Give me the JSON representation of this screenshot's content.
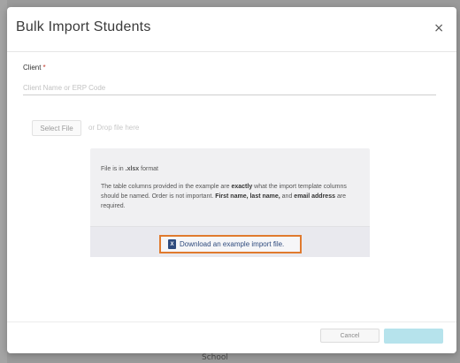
{
  "modal": {
    "title": "Bulk Import Students",
    "close_symbol": "×"
  },
  "client_field": {
    "label": "Client",
    "required_mark": "*",
    "placeholder": "Client Name or ERP Code",
    "value": ""
  },
  "file_select": {
    "button_label": "Select File",
    "drop_text": "or Drop file here"
  },
  "info": {
    "format_prefix": "File is in ",
    "format_ext": ".xlsx",
    "format_suffix": " format",
    "para_part1": "The table columns provided in the example are ",
    "para_bold1": "exactly",
    "para_part2": " what the import template columns should be named. Order is not important. ",
    "para_bold2": "First name, last name,",
    "para_part3": " and ",
    "para_bold3": "email address",
    "para_part4": " are required.",
    "download_link": "Download an example import file."
  },
  "footer": {
    "cancel_label": "Cancel",
    "primary_label": ""
  },
  "background": {
    "school_text": "School"
  },
  "colors": {
    "accent_outline": "#e07a2e",
    "link_blue": "#2e4a7d",
    "primary_button": "#b6e3ec"
  },
  "icons": {
    "close": "close-icon",
    "file": "xlsx-file-icon"
  }
}
